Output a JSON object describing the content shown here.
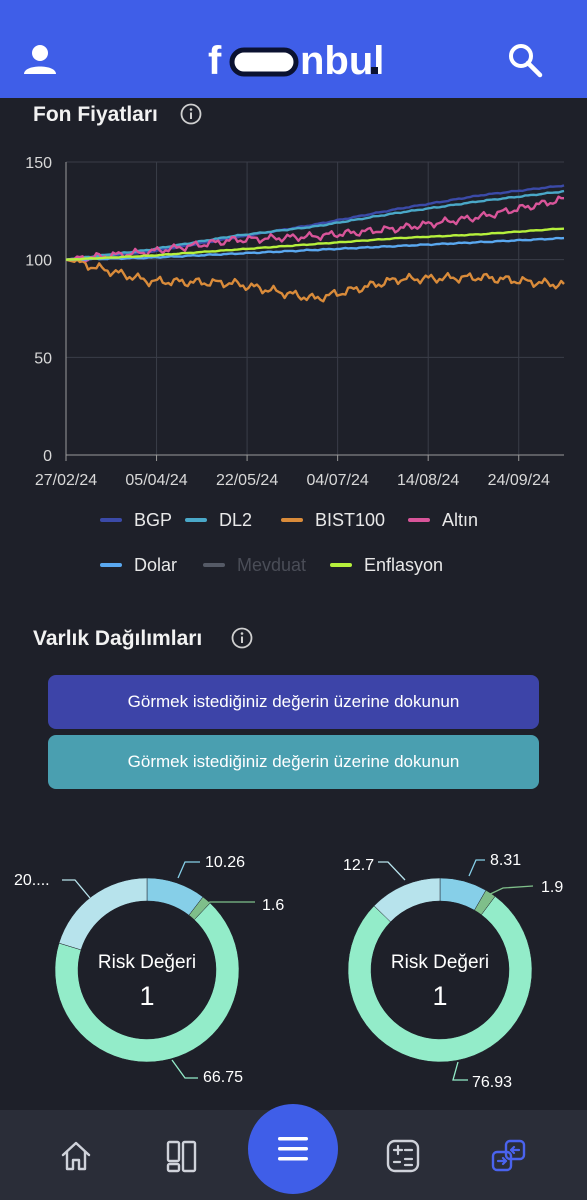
{
  "header": {
    "logo_text": "fonbul.",
    "icons": {
      "user": "user-icon",
      "search": "search-icon"
    },
    "brand_color": "#3f5ee8"
  },
  "fund_prices": {
    "title": "Fon Fiyatları",
    "info_icon": "info-icon"
  },
  "chart_data": {
    "type": "line",
    "x": [
      "27/02/24",
      "05/04/24",
      "22/05/24",
      "04/07/24",
      "14/08/24",
      "24/09/24"
    ],
    "ylim": [
      0,
      150
    ],
    "yticks": [
      0,
      50,
      100,
      150
    ],
    "grid": true,
    "legend_placement": "bottom",
    "series": [
      {
        "name": "BGP",
        "color": "#3b4aa8",
        "values": [
          100,
          104,
          111,
          118,
          126,
          133,
          138
        ]
      },
      {
        "name": "DL2",
        "color": "#4aa8c8",
        "values": [
          100,
          105,
          112,
          117,
          124,
          130,
          135
        ]
      },
      {
        "name": "BIST100",
        "color": "#d98b3a",
        "values": [
          100,
          89,
          88,
          80,
          90,
          91,
          87
        ]
      },
      {
        "name": "Altın",
        "color": "#d9559a",
        "values": [
          100,
          104,
          110,
          112,
          116,
          122,
          131
        ]
      },
      {
        "name": "Dolar",
        "color": "#5aa8f0",
        "values": [
          100,
          101,
          103,
          105,
          107,
          109,
          111
        ]
      },
      {
        "name": "Mevduat",
        "color": "#555a66",
        "values": [],
        "disabled": true
      },
      {
        "name": "Enflasyon",
        "color": "#b6f03c",
        "values": [
          100,
          102,
          105,
          108,
          111,
          113,
          116
        ]
      }
    ]
  },
  "legend": [
    {
      "name": "BGP",
      "color": "#3b4aa8"
    },
    {
      "name": "DL2",
      "color": "#4aa8c8"
    },
    {
      "name": "BIST100",
      "color": "#d98b3a"
    },
    {
      "name": "Altın",
      "color": "#d9559a"
    },
    {
      "name": "Dolar",
      "color": "#5aa8f0"
    },
    {
      "name": "Mevduat",
      "color": "#555a66",
      "disabled": true
    },
    {
      "name": "Enflasyon",
      "color": "#b6f03c"
    }
  ],
  "allocations": {
    "title": "Varlık Dağılımları",
    "prompt_1": "Görmek istediğiniz değerin üzerine dokunun",
    "prompt_2": "Görmek istediğiniz değerin üzerine dokunun",
    "prompt_1_color": "#3d44a8",
    "prompt_2_color": "#4a9fb0"
  },
  "donuts": [
    {
      "center_label": "Risk Değeri",
      "center_value": "1",
      "slices": [
        {
          "value": 10.26,
          "label": "10.26",
          "color": "#86cfe8"
        },
        {
          "value": 1.6,
          "label": "1.6",
          "color": "#7fbf8a"
        },
        {
          "value": 66.75,
          "label": "66.75",
          "color": "#93ecc9"
        },
        {
          "value": 20.0,
          "label": "20....",
          "color": "#b7e3ec"
        }
      ]
    },
    {
      "center_label": "Risk Değeri",
      "center_value": "1",
      "slices": [
        {
          "value": 8.31,
          "label": "8.31",
          "color": "#86cfe8"
        },
        {
          "value": 1.9,
          "label": "1.9",
          "color": "#7fbf8a"
        },
        {
          "value": 76.93,
          "label": "76.93",
          "color": "#93ecc9"
        },
        {
          "value": 12.7,
          "label": "12.7",
          "color": "#b7e3ec"
        }
      ]
    }
  ],
  "bottom_nav": {
    "items": [
      {
        "icon": "home-icon"
      },
      {
        "icon": "dashboard-icon"
      },
      {
        "icon": "menu-icon"
      },
      {
        "icon": "compare-icon"
      },
      {
        "icon": "swap-icon",
        "active": true
      }
    ],
    "active_color": "#3f5ee8"
  }
}
